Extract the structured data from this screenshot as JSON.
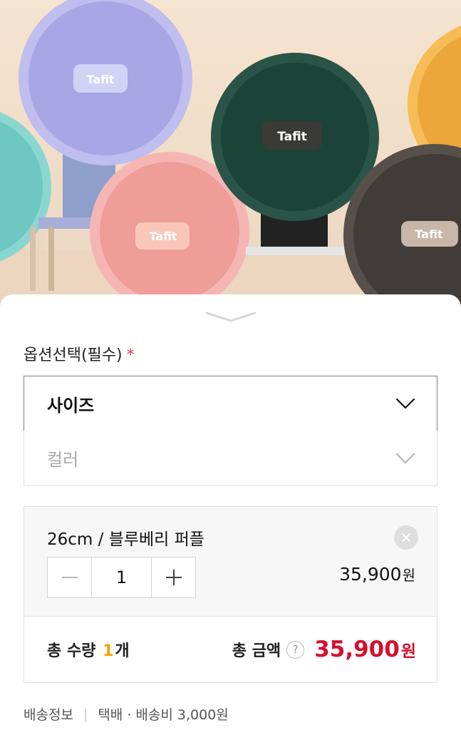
{
  "hero": {
    "brand_label": "Tafit",
    "wheel_colors": {
      "teal": "#86d3cf",
      "purple": "#b9b6ea",
      "pink": "#f2a9a6",
      "green": "#1e473b",
      "orange": "#f3b24a",
      "gray": "#4a4440"
    }
  },
  "sheet": {
    "collapse_icon": "chevron-down-icon",
    "option_title": "옵션선택(필수)",
    "required_mark": "*",
    "selects": {
      "size": "사이즈",
      "color": "컬러"
    }
  },
  "selected_item": {
    "name": "26cm / 블루베리 퍼플",
    "quantity": "1",
    "price": "35,900",
    "currency": "원",
    "minus_symbol": "−",
    "plus_symbol": "+"
  },
  "totals": {
    "quantity_label": "총 수량",
    "quantity_value": "1",
    "quantity_unit": "개",
    "amount_label": "총 금액",
    "help_symbol": "?",
    "amount_value": "35,900",
    "currency": "원"
  },
  "delivery": {
    "label": "배송정보",
    "divider": "|",
    "info": "택배 · 배송비 3,000원"
  },
  "colors": {
    "accent_price": "#d3102f",
    "required": "#e0394d",
    "quantity_highlight": "#f0a400"
  }
}
